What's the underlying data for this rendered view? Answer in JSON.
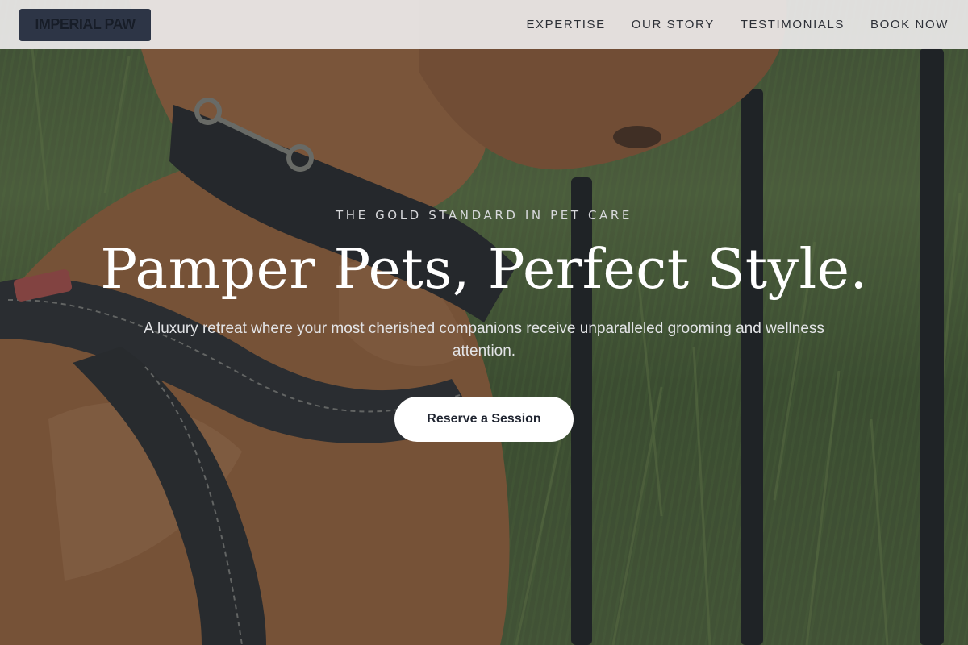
{
  "header": {
    "logo_text": "IMPERIAL PAW",
    "nav": [
      {
        "label": "EXPERTISE"
      },
      {
        "label": "OUR STORY"
      },
      {
        "label": "TESTIMONIALS"
      },
      {
        "label": "BOOK NOW"
      }
    ]
  },
  "hero": {
    "eyebrow": "THE GOLD STANDARD IN PET CARE",
    "headline": "Pamper Pets, Perfect Style.",
    "subtext": "A luxury retreat where your most cherished companions receive unparalleled grooming and wellness attention.",
    "cta_label": "Reserve a Session",
    "background_description_icon": "dog-photo"
  },
  "colors": {
    "header_bg": "#eceaea",
    "logo_bg": "#2d3546",
    "nav_text": "#2c2f36",
    "cta_bg": "#ffffff",
    "cta_text": "#1f2430"
  }
}
